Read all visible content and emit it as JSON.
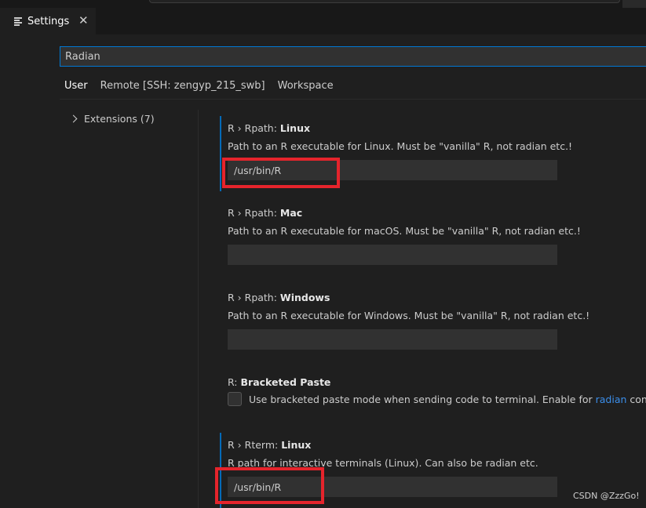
{
  "tab": {
    "label": "Settings",
    "close": "✕"
  },
  "search": {
    "value": "Radian"
  },
  "scopes": [
    "User",
    "Remote [SSH: zengyp_215_swb]",
    "Workspace"
  ],
  "toc": {
    "label": "Extensions",
    "count": "(7)"
  },
  "settings": {
    "rpath_linux": {
      "prefix": "R › Rpath: ",
      "name": "Linux",
      "desc": "Path to an R executable for Linux. Must be \"vanilla\" R, not radian etc.!",
      "value": "/usr/bin/R"
    },
    "rpath_mac": {
      "prefix": "R › Rpath: ",
      "name": "Mac",
      "desc": "Path to an R executable for macOS. Must be \"vanilla\" R, not radian etc.!",
      "value": ""
    },
    "rpath_windows": {
      "prefix": "R › Rpath: ",
      "name": "Windows",
      "desc": "Path to an R executable for Windows. Must be \"vanilla\" R, not radian etc.!",
      "value": ""
    },
    "bracketed_paste": {
      "prefix": "R: ",
      "name": "Bracketed Paste",
      "desc_before": "Use bracketed paste mode when sending code to terminal. Enable for ",
      "link": "radian",
      "desc_after": " console.",
      "checked": false
    },
    "rterm_linux": {
      "prefix": "R › Rterm: ",
      "name": "Linux",
      "desc": "R path for interactive terminals (Linux). Can also be radian etc.",
      "value": "/usr/bin/R"
    }
  },
  "watermark": "CSDN @ZzzGo!",
  "colors": {
    "accent": "#0078d4",
    "highlight": "#e5242c",
    "link": "#3b8eea"
  }
}
